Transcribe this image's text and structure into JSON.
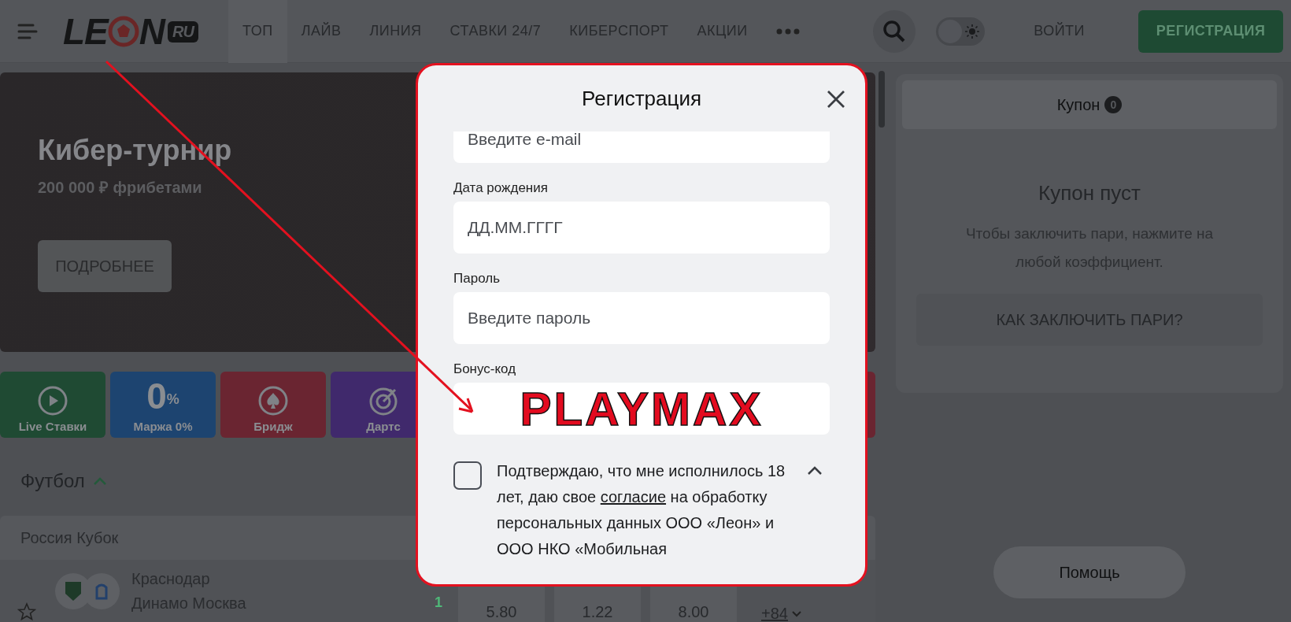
{
  "header": {
    "logo": {
      "left": "LE",
      "right": "N",
      "badge": "RU"
    },
    "nav": [
      {
        "label": "ТОП",
        "selected": true
      },
      {
        "label": "ЛАЙВ",
        "selected": false
      },
      {
        "label": "ЛИНИЯ",
        "selected": false
      },
      {
        "label": "СТАВКИ 24/7",
        "selected": false
      },
      {
        "label": "КИБЕРСПОРТ",
        "selected": false
      },
      {
        "label": "АКЦИИ",
        "selected": false
      }
    ],
    "theme_toggle": {
      "on": false
    },
    "login": "ВОЙТИ",
    "register": "РЕГИСТРАЦИЯ"
  },
  "banner": {
    "title": "Кибер-турнир",
    "subtitle": "200 000 ₽ фрибетами",
    "button": "ПОДРОБНЕЕ"
  },
  "tiles": [
    {
      "kind": "live",
      "label": "Live Ставки",
      "color": "#1f4a33"
    },
    {
      "kind": "margin",
      "label": "Маржа 0%",
      "big": "0",
      "sup": "%",
      "color": "#1d4470"
    },
    {
      "kind": "bridge",
      "label": "Бридж",
      "color": "#6a2531"
    },
    {
      "kind": "darts",
      "label": "Дартс",
      "color": "#40296c"
    },
    {
      "kind": "blank",
      "color": "#6a2531"
    }
  ],
  "sport": {
    "title": "Футбол",
    "expanded": true,
    "league": "Россия Кубок",
    "match": {
      "teams": [
        {
          "name": "Краснодар"
        },
        {
          "name": "Динамо Москва",
          "score": "1"
        }
      ],
      "odds": [
        "5.80",
        "1.22",
        "8.00"
      ],
      "more": "+84"
    }
  },
  "coupon": {
    "tab": "Купон",
    "count": "0",
    "empty_title": "Купон пуст",
    "empty_text": "Чтобы заключить пари, нажмите на любой коэффициент.",
    "how_button": "КАК ЗАКЛЮЧИТЬ ПАРИ?",
    "help": "Помощь"
  },
  "modal": {
    "title": "Регистрация",
    "fields": [
      {
        "placeholder": "Введите e-mail"
      },
      {
        "label": "Дата рождения",
        "placeholder": "ДД.ММ.ГГГГ"
      },
      {
        "label": "Пароль",
        "placeholder": "Введите пароль"
      },
      {
        "label": "Бонус-код",
        "value": "PLAYMAX"
      }
    ],
    "consent": {
      "checked": false,
      "expanded": true,
      "before": "Подтверждаю, что мне исполнилось 18 лет, даю свое",
      "link": "согласие",
      "after": "на обработку персональных данных ООО «Леон» и ООО НКО «Мобильная"
    }
  }
}
